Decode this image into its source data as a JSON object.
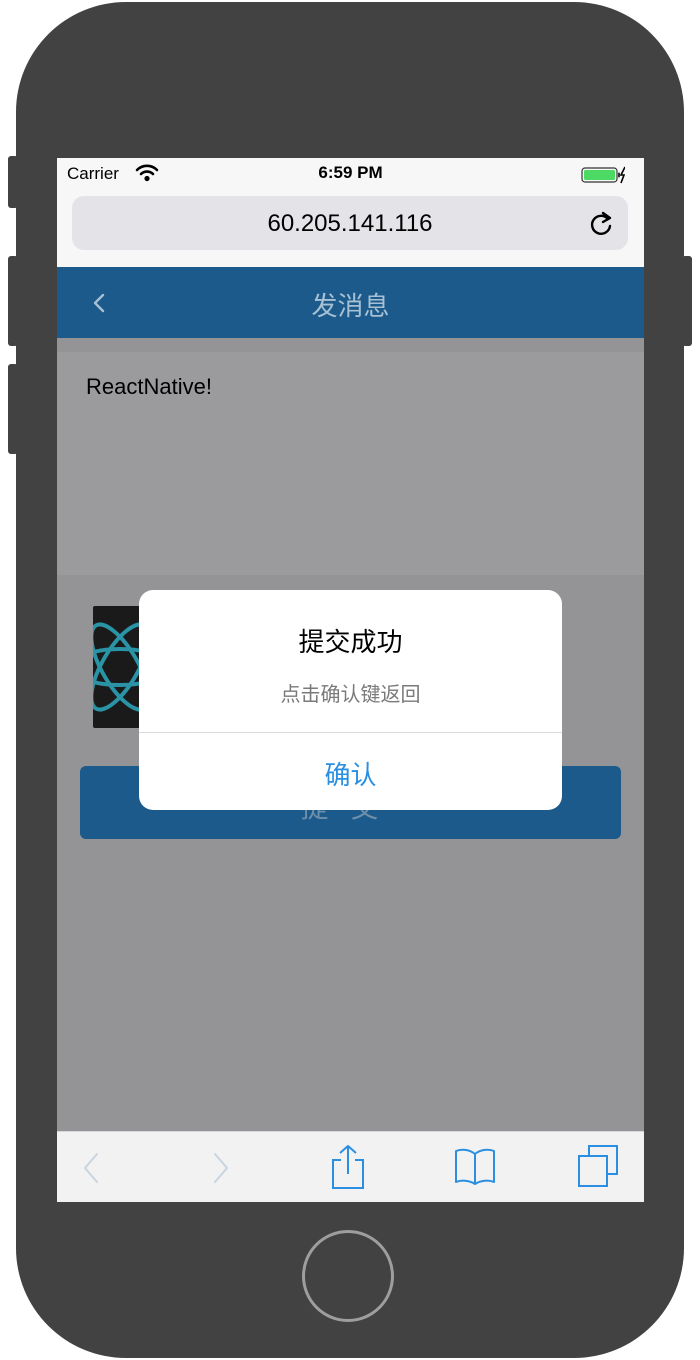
{
  "status_bar": {
    "carrier": "Carrier",
    "time": "6:59 PM"
  },
  "browser": {
    "url": "60.205.141.116"
  },
  "nav": {
    "title": "发消息"
  },
  "compose": {
    "text": "ReactNative!"
  },
  "submit": {
    "label": "提交"
  },
  "alert": {
    "title": "提交成功",
    "message": "点击确认键返回",
    "confirm_label": "确认"
  },
  "colors": {
    "nav_bar": "#1b5a8a",
    "alert_button": "#2a8fe0",
    "toolbar_icons": "#2a8fe0"
  },
  "icons": {
    "status": [
      "wifi-icon",
      "battery-charging-icon"
    ],
    "browser": [
      "reload-icon"
    ],
    "nav": [
      "back-chevron-icon"
    ],
    "toolbar": [
      "back-arrow-icon",
      "forward-arrow-icon",
      "share-icon",
      "bookmarks-icon",
      "tabs-icon"
    ],
    "content": [
      "react-logo-icon"
    ]
  }
}
